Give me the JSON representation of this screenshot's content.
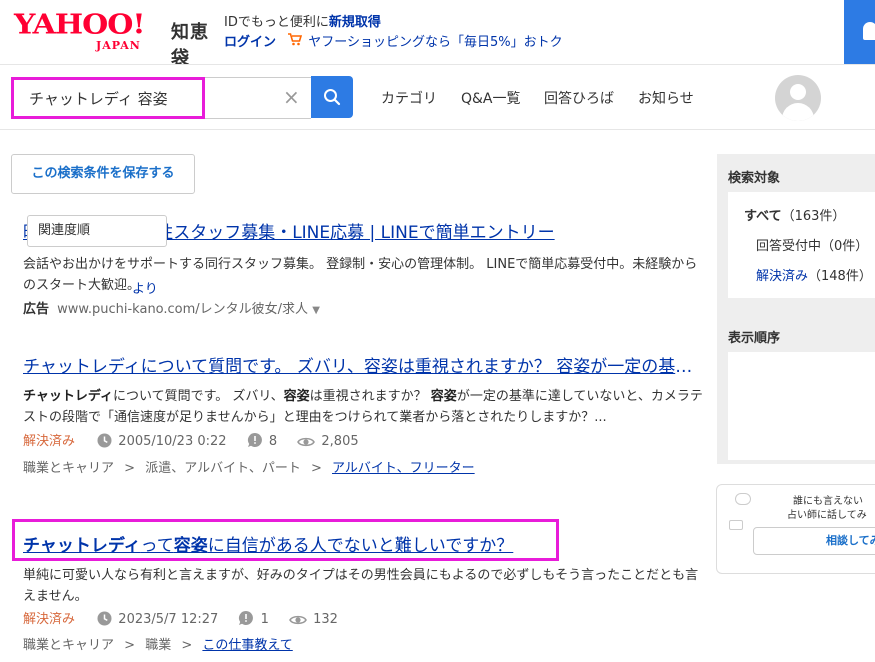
{
  "header": {
    "logo_yahoo": "YAHOO!",
    "logo_japan": "JAPAN",
    "logo_service": "知恵袋",
    "id_text": "IDでもっと便利に",
    "id_link": "新規取得",
    "login": "ログイン",
    "shopping_text": "ヤフーショッピングなら「毎日5%」おトク"
  },
  "search": {
    "value": "チャットレディ 容姿",
    "clear": "×"
  },
  "nav": {
    "category": "カテゴリ",
    "qa_list": "Q&A一覧",
    "answer_plaza": "回答ひろば",
    "news": "お知らせ"
  },
  "save_button": "この検索条件を保存する",
  "ad": {
    "title": "時給3,000円 | 女性スタッフ募集・LINE応募 | LINEで簡単エントリー",
    "desc": "会話やお出かけをサポートする同行スタッフ募集。 登録制・安心の管理体制。 LINEで簡単応募受付中。未経験からのスタート大歓迎。",
    "label": "広告",
    "url": "www.puchi-kano.com/レンタル彼女/求人"
  },
  "results": [
    {
      "title": "チャットレディについて質問です。 ズバリ、容姿は重視されますか？ 容姿が一定の基準に達していないと、",
      "desc_1": "チャットレディ",
      "desc_2": "について質問です。 ズバリ、",
      "desc_3": "容姿",
      "desc_4": "は重視されますか？ ",
      "desc_5": "容姿",
      "desc_6": "が一定の基準に達していないと、カメラテストの段階で「通信速度が足りませんから」と理由をつけられて業者から落とされたりしますか？...",
      "status": "解決済み",
      "date": "2005/10/23 0:22",
      "answers": "8",
      "views": "2,805",
      "cat1": "職業とキャリア",
      "cat2": "派遣、アルバイト、パート",
      "cat3": "アルバイト、フリーター",
      "sep": ">"
    },
    {
      "title_1": "チャットレディ",
      "title_2": "って",
      "title_3": "容姿",
      "title_4": "に自信がある人でないと難しいですか？",
      "desc": "単純に可愛い人なら有利と言えますが、好みのタイプはその男性会員にもよるので必ずしもそう言ったことだとも言えません。",
      "status": "解決済み",
      "date": "2023/5/7 12:27",
      "answers": "1",
      "views": "132",
      "cat1": "職業とキャリア",
      "cat2": "職業",
      "cat3": "この仕事教えて",
      "sep": ">"
    }
  ],
  "sidebar": {
    "target_heading": "検索対象",
    "all": "すべて",
    "all_count": "（163件）",
    "accepting": "回答受付中",
    "accepting_count": "（0件）",
    "solved": "解決済み",
    "solved_count": "（148件）",
    "order_heading": "表示順序",
    "order_value": "関連度順",
    "more": "より"
  },
  "promo": {
    "line1": "誰にも言えない",
    "line2": "占い師に話してみ",
    "button": "相談してみ"
  },
  "colors": {
    "link": "#0034aa",
    "accent_blue": "#2d7be4",
    "solved": "#d7683c",
    "highlight": "#e81cd9",
    "brand": "#ff0033"
  }
}
